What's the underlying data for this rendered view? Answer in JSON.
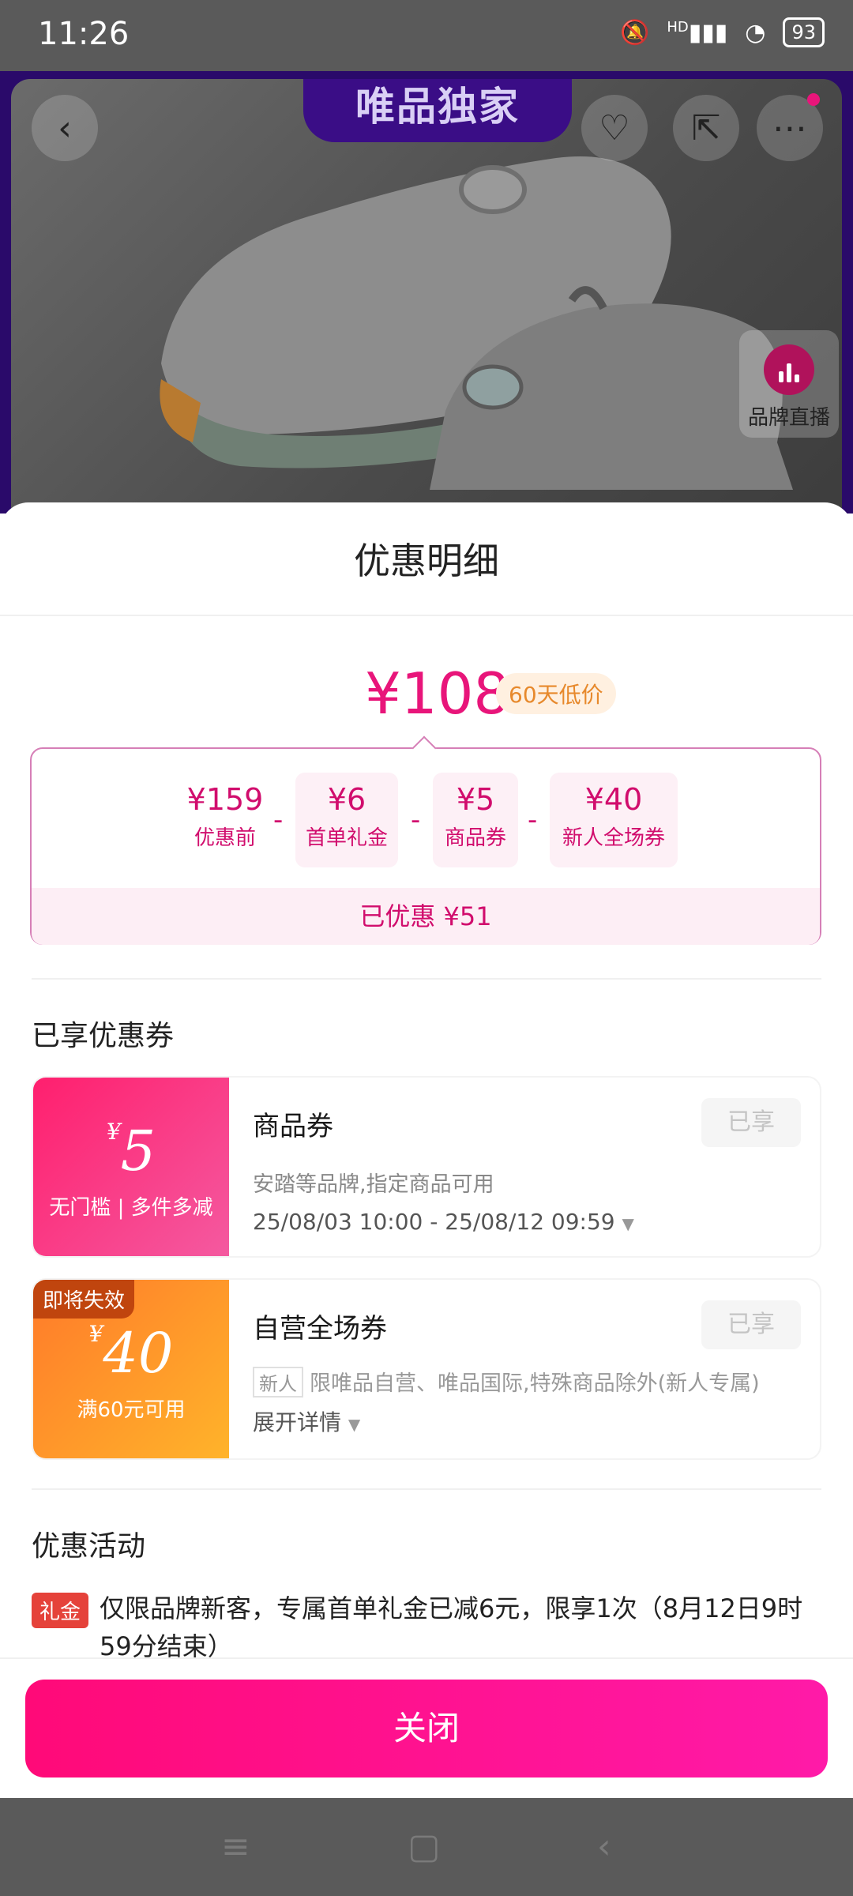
{
  "status_bar": {
    "time": "11:26",
    "signal": "HD",
    "battery": "93"
  },
  "hero": {
    "banner_text": "唯品独家",
    "live_label": "品牌直播"
  },
  "sheet": {
    "title": "优惠明细",
    "final_price": "¥108",
    "price_tag": "60天低价",
    "breakdown": [
      {
        "value": "¥159",
        "label": "优惠前"
      },
      {
        "value": "¥6",
        "label": "首单礼金"
      },
      {
        "value": "¥5",
        "label": "商品券"
      },
      {
        "value": "¥40",
        "label": "新人全场券"
      }
    ],
    "minus": "-",
    "saved_text": "已优惠 ¥51"
  },
  "coupons_section": {
    "title": "已享优惠券",
    "coupons": [
      {
        "currency": "¥",
        "amount": "5",
        "condition": "无门槛 | 多件多减",
        "name": "商品券",
        "desc": "安踏等品牌,指定商品可用",
        "date": "25/08/03 10:00 - 25/08/12 09:59",
        "status": "已享"
      },
      {
        "badge": "即将失效",
        "currency": "¥",
        "amount": "40",
        "condition": "满60元可用",
        "name": "自营全场券",
        "new_tag": "新人",
        "desc": "限唯品自营、唯品国际,特殊商品除外(新人专属)",
        "expand": "展开详情",
        "status": "已享"
      }
    ]
  },
  "activities_section": {
    "title": "优惠活动",
    "tag": "礼金",
    "text": "仅限品牌新客，专属首单礼金已减6元，限享1次（8月12日9时59分结束）"
  },
  "footer": {
    "close_label": "关闭"
  }
}
